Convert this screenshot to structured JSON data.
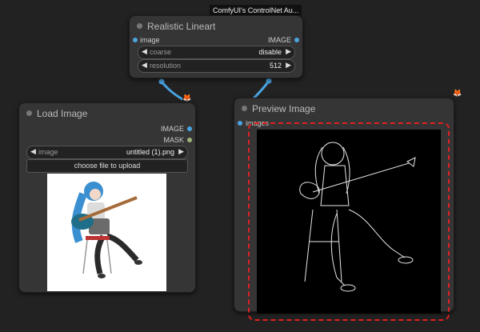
{
  "group_title": "ComfyUI's ControlNet Au...",
  "lineart_node": {
    "title": "Realistic Lineart",
    "input_label": "image",
    "output_label": "IMAGE",
    "widgets": [
      {
        "label": "coarse",
        "value": "disable"
      },
      {
        "label": "resolution",
        "value": "512"
      }
    ]
  },
  "load_node": {
    "title": "Load Image",
    "outputs": [
      "IMAGE",
      "MASK"
    ],
    "image_widget": {
      "label": "image",
      "value": "untitled (1).png"
    },
    "upload_button": "choose file to upload"
  },
  "preview_node": {
    "title": "Preview Image",
    "input_label": "images"
  },
  "icons": {
    "badge": "fox-icon",
    "arrow_left": "arrow-left-icon",
    "arrow_right": "arrow-right-icon"
  },
  "colors": {
    "link": "#4aa3e0",
    "selection": "#e02020",
    "canvas": "#222222",
    "node": "#353535"
  }
}
